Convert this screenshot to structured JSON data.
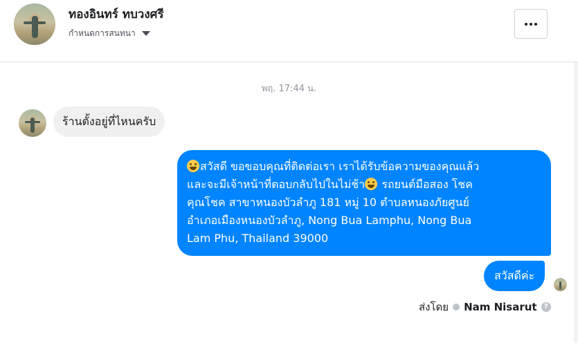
{
  "header": {
    "contact_name": "ทองอินทร์ ทบวงศรี",
    "subtitle": "กำหนดการสนทนา",
    "more_label": "•••"
  },
  "conversation": {
    "timestamp": "พฤ. 17:44 น.",
    "incoming_message": "ร้านตั้งอยู่ที่ไหนครับ",
    "auto_reply_lines": [
      "สวัสดี ขอขอบคุณที่ติดต่อเรา เราได้รับข้อความของคุณแล้ว",
      "และจะมีเจ้าหน้าที่ตอบกลับไปในไม่ช้า",
      " รถยนต์มือสอง โชค",
      "คุณโชค สาขาหนองบัวลำภู 181 หมู่ 10  ตำบลหนองภัยศูนย์",
      "อำเภอเมืองหนองบัวลำภู, Nong Bua Lamphu, Nong Bua",
      "Lam Phu, Thailand 39000"
    ],
    "outgoing_message": "สวัสดีค่ะ",
    "sent_by_label": "ส่งโดย",
    "sent_by_name": "Nam Nisarut",
    "help_glyph": "?"
  },
  "icons": {
    "emoji": "grinning-face-emoji",
    "caret": "caret-down-icon",
    "more": "more-dots-icon",
    "check": "checkmark-circle-icon",
    "help": "question-circle-icon"
  },
  "colors": {
    "outgoing_bubble": "#0084ff",
    "incoming_bubble": "#f1f0f0",
    "meta_text": "#90949c"
  }
}
